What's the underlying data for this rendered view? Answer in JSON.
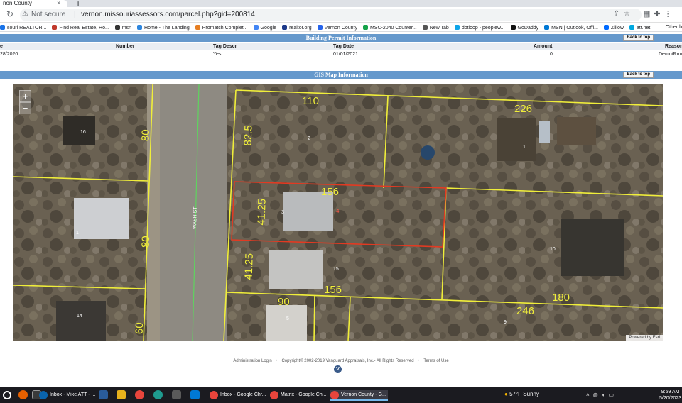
{
  "browser": {
    "tab_title": "non County",
    "address_warning": "Not secure",
    "url": "vernon.missouriassessors.com/parcel.php?gid=200814",
    "bookmarks": [
      {
        "label": "souri REALTOR...",
        "color": "#1a73e8"
      },
      {
        "label": "Find Real Estate, Ho...",
        "color": "#c0392b"
      },
      {
        "label": "msn",
        "color": "#333333"
      },
      {
        "label": "Home - The Landing",
        "color": "#2e86de"
      },
      {
        "label": "Promatch Complet...",
        "color": "#e67e22"
      },
      {
        "label": "Google",
        "color": "#4285f4"
      },
      {
        "label": "realtor.org",
        "color": "#1e3a8a"
      },
      {
        "label": "Vernon County",
        "color": "#2563eb"
      },
      {
        "label": "MSC-2040 Counter...",
        "color": "#16a34a"
      },
      {
        "label": "New Tab",
        "color": "#555555"
      },
      {
        "label": "dotloop - peoplew...",
        "color": "#0ea5e9"
      },
      {
        "label": "GoDaddy",
        "color": "#111111"
      },
      {
        "label": "MSN | Outlook, Offi...",
        "color": "#0078d4"
      },
      {
        "label": "Zillow",
        "color": "#006aff"
      },
      {
        "label": "att.net",
        "color": "#00a8e0"
      }
    ],
    "other_bookmarks": "Other b"
  },
  "permit": {
    "header": "Building Permit Information",
    "back_label": "Back to top",
    "columns": [
      "e",
      "Number",
      "Tag Descr",
      "Tag Date",
      "Amount",
      "Reason"
    ],
    "row": [
      "28/2020",
      "",
      "Yes",
      "01/01/2021",
      "0",
      "Demo/Rmvl"
    ]
  },
  "gis": {
    "header": "GIS Map Information",
    "back_label": "Back to top",
    "zoom_in": "+",
    "zoom_out": "−",
    "powered_by": "Powered by Esri",
    "street_name": "WASH ST",
    "dimensions": [
      "110",
      "226",
      "82.5",
      "80",
      "156",
      "41.25",
      "80",
      "41.25",
      "156",
      "90",
      "180",
      "246",
      "60"
    ],
    "parcel_numbers": [
      "16",
      "2",
      "1",
      "3",
      "4",
      "15",
      "1",
      "10",
      "14",
      "5",
      "9"
    ]
  },
  "footer": {
    "admin_login": "Administration Login",
    "copyright": "Copyright© 2002-2019 Vanguard Appraisals, Inc.- All Rights Reserved",
    "terms": "Terms of Use",
    "logo": "V"
  },
  "taskbar": {
    "apps": [
      {
        "label": "Inbox - Mike ATT - ...",
        "color": "#0a64ad"
      },
      {
        "label": "Inbox - Google Chr...",
        "color": "#e8453c"
      },
      {
        "label": "Matrix - Google Ch...",
        "color": "#e8453c"
      },
      {
        "label": "Vernon County - G...",
        "color": "#e8453c"
      }
    ],
    "weather_temp": "57°F",
    "weather_desc": "Sunny",
    "time": "9:59 AM",
    "date": "5/20/2023"
  }
}
